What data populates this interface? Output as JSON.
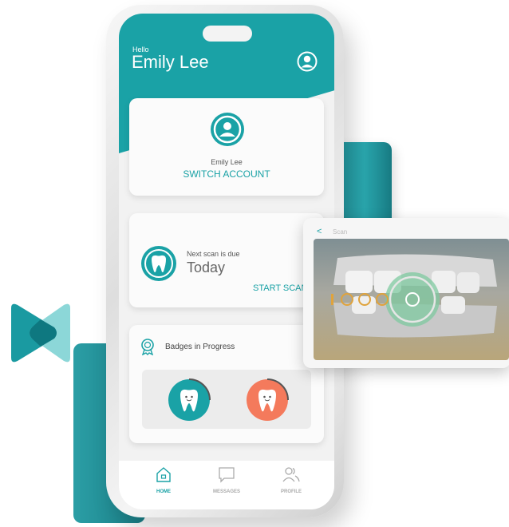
{
  "header": {
    "greeting": "Hello",
    "user_name": "Emily Lee"
  },
  "account_card": {
    "name": "Emily Lee",
    "action_label": "SWITCH ACCOUNT"
  },
  "scan_card": {
    "due_label": "Next scan is due",
    "due_value": "Today",
    "action_label": "START SCAN"
  },
  "badges_card": {
    "title": "Badges in Progress",
    "badges": [
      {
        "color": "#1aa2a6",
        "icon": "happy-tooth-icon"
      },
      {
        "color": "#f47a5c",
        "icon": "happy-tooth-icon"
      }
    ]
  },
  "nav": {
    "items": [
      {
        "label": "HOME",
        "icon": "home-icon"
      },
      {
        "label": "MESSAGES",
        "icon": "chat-icon"
      },
      {
        "label": "PROFILE",
        "icon": "users-icon"
      }
    ]
  },
  "scan_preview": {
    "back_label": "<",
    "title": "Scan"
  },
  "colors": {
    "primary": "#1aa2a6",
    "accent": "#f47a5c",
    "dark_teal": "#1f8f98"
  }
}
